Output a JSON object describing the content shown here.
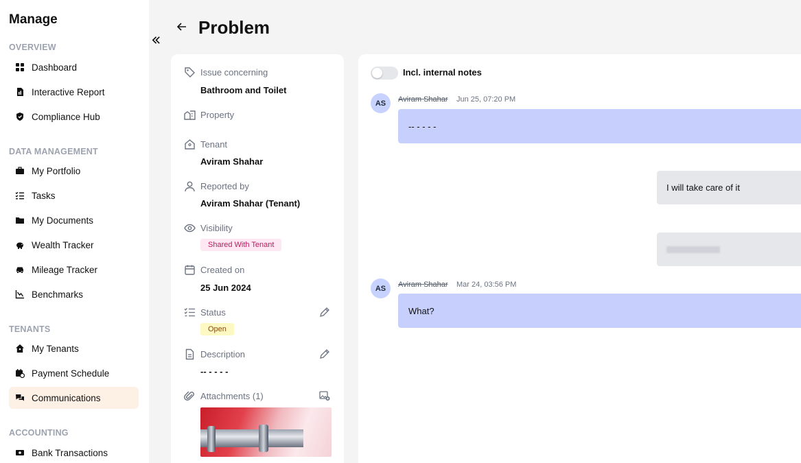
{
  "sidebar": {
    "brand": "Manage",
    "sections": {
      "overview": "OVERVIEW",
      "data_management": "DATA MANAGEMENT",
      "tenants": "TENANTS",
      "accounting": "ACCOUNTING"
    },
    "items": {
      "dashboard": "Dashboard",
      "interactive_report": "Interactive Report",
      "compliance_hub": "Compliance Hub",
      "my_portfolio": "My Portfolio",
      "tasks": "Tasks",
      "my_documents": "My Documents",
      "wealth_tracker": "Wealth Tracker",
      "mileage_tracker": "Mileage Tracker",
      "benchmarks": "Benchmarks",
      "my_tenants": "My Tenants",
      "payment_schedule": "Payment Schedule",
      "communications": "Communications",
      "bank_transactions": "Bank Transactions"
    },
    "active_item": "Communications"
  },
  "header": {
    "title": "Problem"
  },
  "details": {
    "issue_label": "Issue concerning",
    "issue_value": "Bathroom and Toilet",
    "property_label": "Property",
    "tenant_label": "Tenant",
    "tenant_value": "Aviram Shahar",
    "reported_label": "Reported by",
    "reported_value": "Aviram Shahar (Tenant)",
    "visibility_label": "Visibility",
    "visibility_badge": "Shared With Tenant",
    "created_label": "Created on",
    "created_value": "25 Jun 2024",
    "status_label": "Status",
    "status_badge": "Open",
    "description_label": "Description",
    "description_value": "-- - - - -",
    "attachments_label": "Attachments (1)"
  },
  "chat": {
    "toggle_label": "Incl. internal notes",
    "toggle_on": false,
    "messages": [
      {
        "avatar": "AS",
        "sender": "Aviram Shahar",
        "time": "Jun 25, 07:20 PM",
        "text": "-- - - - -"
      },
      {
        "text": "I will take care of it"
      },
      {
        "text": ""
      },
      {
        "avatar": "AS",
        "sender": "Aviram Shahar",
        "time": "Mar 24, 03:56 PM",
        "text": "What?"
      }
    ]
  },
  "colors": {
    "active_nav_bg": "#fdf0e4",
    "incoming_bubble": "#c7d0fd",
    "outgoing_bubble": "#e5e7eb",
    "visibility_badge_bg": "#fce7f3",
    "status_badge_bg": "#fef9c3"
  }
}
